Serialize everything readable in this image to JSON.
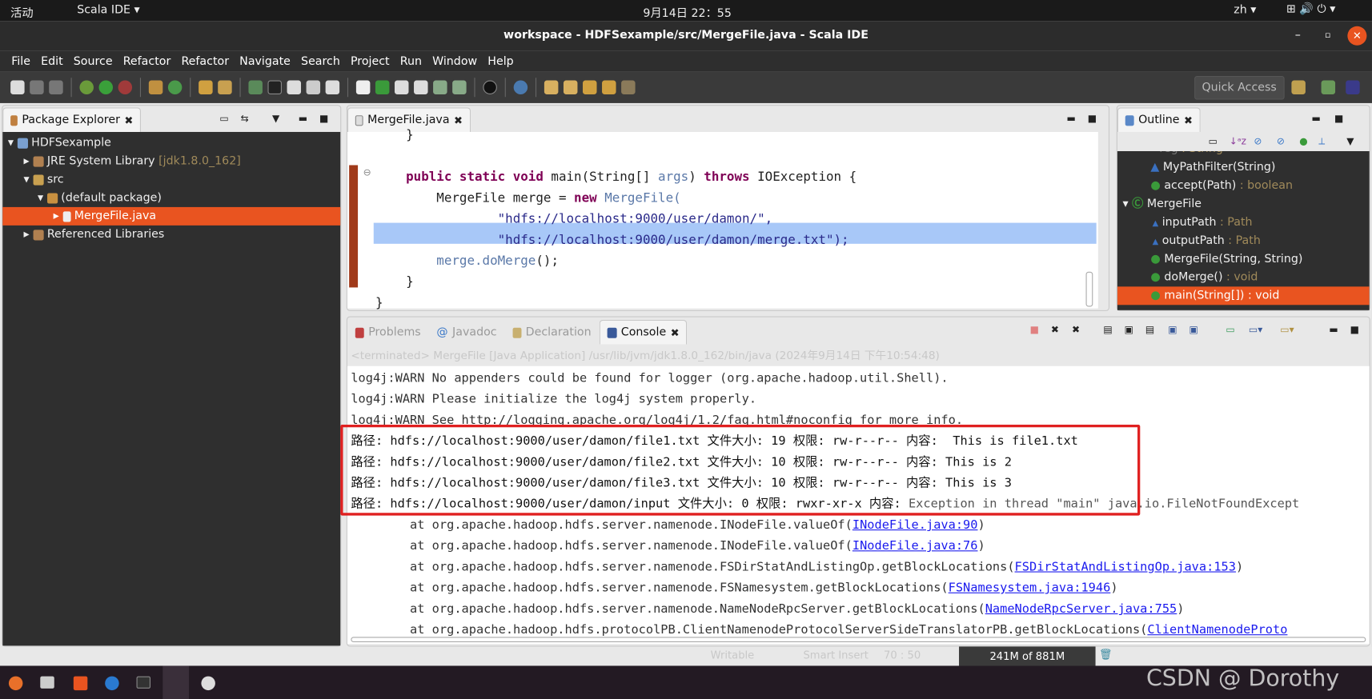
{
  "topbar": {
    "activities": "活动",
    "app": "Scala IDE ▾",
    "clock": "9月14日  22：55",
    "lang": "zh ▾"
  },
  "window": {
    "title": "workspace - HDFSexample/src/MergeFile.java - Scala IDE"
  },
  "menu": [
    "File",
    "Edit",
    "Source",
    "Refactor",
    "Refactor",
    "Navigate",
    "Search",
    "Project",
    "Run",
    "Window",
    "Help"
  ],
  "toolbar": {
    "quick_access": "Quick Access"
  },
  "package_explorer": {
    "tab": "Package Explorer",
    "items": [
      {
        "label": "HDFSexample",
        "extra": ""
      },
      {
        "label": "JRE System Library",
        "extra": "[jdk1.8.0_162]"
      },
      {
        "label": "src",
        "extra": ""
      },
      {
        "label": "(default package)",
        "extra": ""
      },
      {
        "label": "MergeFile.java",
        "extra": ""
      },
      {
        "label": "Referenced Libraries",
        "extra": ""
      }
    ]
  },
  "editor": {
    "tab": "MergeFile.java",
    "lines": {
      "l0": "    }",
      "l2a": "public static void",
      "l2b": " main(String[] ",
      "l2c": "args",
      "l2d": ") ",
      "l2e": "throws",
      "l2f": " IOException {",
      "l3a": "MergeFile merge = ",
      "l3b": "new",
      "l3c": " MergeFile(",
      "l4": "\"hdfs://localhost:9000/user/damon/\",",
      "l5": "\"hdfs://localhost:9000/user/damon/merge.txt\");",
      "l6a": "merge.",
      "l6b": "doMerge",
      "l6c": "();",
      "l7": "}",
      "l8": "}"
    }
  },
  "outline": {
    "tab": "Outline",
    "items": [
      {
        "label": "reg",
        "type": " : String"
      },
      {
        "label": "MyPathFilter(String)",
        "type": ""
      },
      {
        "label": "accept(Path)",
        "type": " : boolean"
      },
      {
        "label": "MergeFile",
        "type": ""
      },
      {
        "label": "inputPath",
        "type": " : Path"
      },
      {
        "label": "outputPath",
        "type": " : Path"
      },
      {
        "label": "MergeFile(String, String)",
        "type": ""
      },
      {
        "label": "doMerge()",
        "type": " : void"
      },
      {
        "label": "main(String[])",
        "type": " : void"
      }
    ]
  },
  "console": {
    "tabs": [
      "Problems",
      "Javadoc",
      "Declaration",
      "Console"
    ],
    "terminated": "<terminated> MergeFile [Java Application] /usr/lib/jvm/jdk1.8.0_162/bin/java (2024年9月14日 下午10:54:48)",
    "lines": [
      "log4j:WARN No appenders could be found for logger (org.apache.hadoop.util.Shell).",
      "log4j:WARN Please initialize the log4j system properly.",
      "log4j:WARN See http://logging.apache.org/log4j/1.2/faq.html#noconfig for more info.",
      "路径: hdfs://localhost:9000/user/damon/file1.txt 文件大小: 19 权限: rw-r--r-- 内容:  This is file1.txt",
      "路径: hdfs://localhost:9000/user/damon/file2.txt 文件大小: 10 权限: rw-r--r-- 内容: This is 2",
      "路径: hdfs://localhost:9000/user/damon/file3.txt 文件大小: 10 权限: rw-r--r-- 内容: This is 3"
    ],
    "last_a": "路径: hdfs://localhost:9000/user/damon/input 文件大小: 0 权限: rwxr-xr-x 内容: ",
    "last_b": "Exception in thread \"main\" java.io.FileNotFoundExcept",
    "stack": [
      {
        "pre": "        at org.apache.hadoop.hdfs.server.namenode.INodeFile.valueOf(",
        "link": "INodeFile.java:90",
        "post": ")"
      },
      {
        "pre": "        at org.apache.hadoop.hdfs.server.namenode.INodeFile.valueOf(",
        "link": "INodeFile.java:76",
        "post": ")"
      },
      {
        "pre": "        at org.apache.hadoop.hdfs.server.namenode.FSDirStatAndListingOp.getBlockLocations(",
        "link": "FSDirStatAndListingOp.java:153",
        "post": ")"
      },
      {
        "pre": "        at org.apache.hadoop.hdfs.server.namenode.FSNamesystem.getBlockLocations(",
        "link": "FSNamesystem.java:1946",
        "post": ")"
      },
      {
        "pre": "        at org.apache.hadoop.hdfs.server.namenode.NameNodeRpcServer.getBlockLocations(",
        "link": "NameNodeRpcServer.java:755",
        "post": ")"
      },
      {
        "pre": "        at org.apache.hadoop.hdfs.protocolPB.ClientNamenodeProtocolServerSideTranslatorPB.getBlockLocations(",
        "link": "ClientNamenodeProto",
        "post": ""
      }
    ]
  },
  "status": {
    "writable": "Writable",
    "insert": "Smart Insert",
    "pos": "70 : 50",
    "heap": "241M of 881M"
  },
  "watermark": "CSDN @  Dorothy",
  "colors": {
    "selection": "#e95420",
    "highlight": "#a8c8f8",
    "annotation_box": "#e02020"
  }
}
